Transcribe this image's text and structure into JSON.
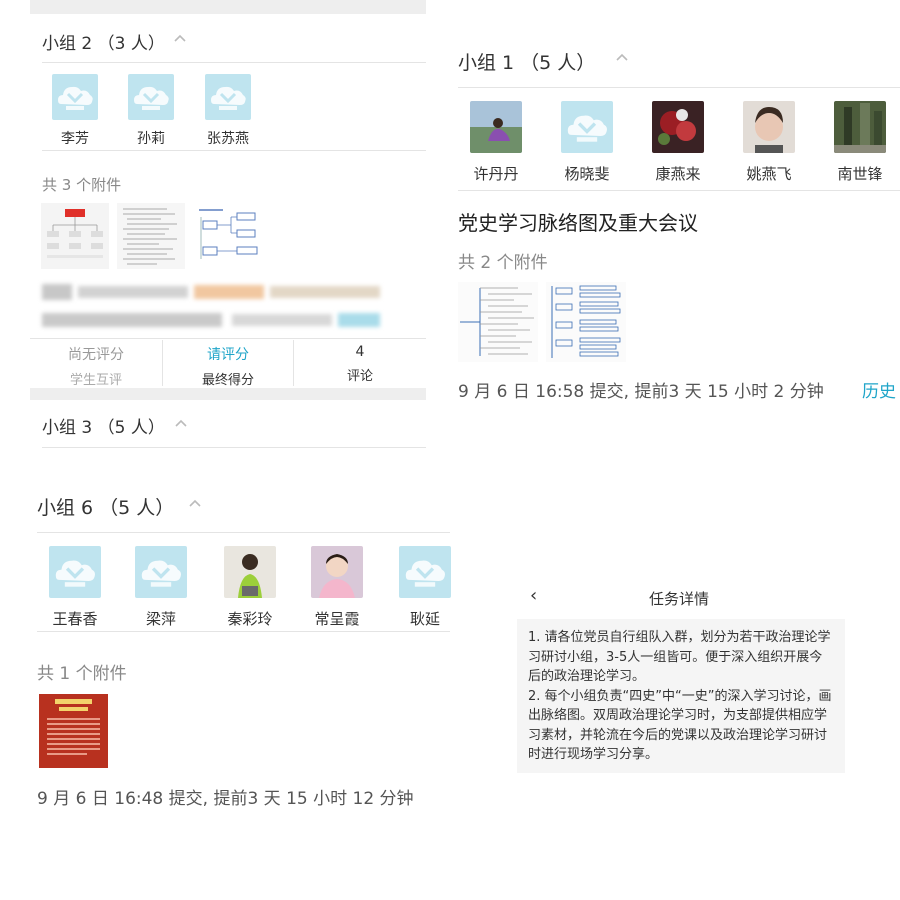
{
  "colors": {
    "accent": "#1fa5c9",
    "muted": "#888888",
    "placeholder_avatar": "#bfe4ef"
  },
  "left_panel": {
    "group2": {
      "title": "小组 2 （3 人）",
      "members": [
        {
          "name": "李芳",
          "avatar": "placeholder-icon"
        },
        {
          "name": "孙莉",
          "avatar": "placeholder-icon"
        },
        {
          "name": "张苏燕",
          "avatar": "placeholder-icon"
        }
      ],
      "attachments_count": "共 3 个附件",
      "score": {
        "peer_value": "尚无评分",
        "peer_label": "学生互评",
        "final_value": "请评分",
        "final_label": "最终得分",
        "comments_value": "4",
        "comments_label": "评论"
      }
    },
    "group3": {
      "title": "小组 3 （5 人）"
    },
    "group6": {
      "title": "小组 6 （5 人）",
      "members": [
        {
          "name": "王春香",
          "avatar": "placeholder-icon"
        },
        {
          "name": "梁萍",
          "avatar": "placeholder-icon"
        },
        {
          "name": "秦彩玲",
          "avatar": "photo"
        },
        {
          "name": "常呈霞",
          "avatar": "photo"
        },
        {
          "name": "耿延",
          "avatar": "placeholder-icon"
        }
      ],
      "attachments_count": "共 1 个附件",
      "submit_info": "9 月 6 日 16:48 提交, 提前3 天 15 小时 12 分钟"
    }
  },
  "right_panel": {
    "group1": {
      "title": "小组 1 （5 人）",
      "members": [
        {
          "name": "许丹丹",
          "avatar": "photo"
        },
        {
          "name": "杨晓斐",
          "avatar": "placeholder-icon"
        },
        {
          "name": "康燕来",
          "avatar": "photo"
        },
        {
          "name": "姚燕飞",
          "avatar": "photo"
        },
        {
          "name": "南世锋",
          "avatar": "photo"
        }
      ],
      "assignment_title": "党史学习脉络图及重大会议",
      "attachments_count": "共 2 个附件",
      "submit_info": "9 月 6 日 16:58 提交, 提前3 天 15 小时 2 分钟",
      "history_label": "历史"
    },
    "task_detail": {
      "title": "任务详情",
      "back_icon": "‹",
      "paragraph1": "1. 请各位党员自行组队入群，划分为若干政治理论学习研讨小组，3-5人一组皆可。便于深入组织开展今后的政治理论学习。",
      "paragraph2": "2. 每个小组负责“四史”中“一史”的深入学习讨论，画出脉络图。双周政治理论学习时，为支部提供相应学习素材，并轮流在今后的党课以及政治理论学习研讨时进行现场学习分享。"
    }
  }
}
